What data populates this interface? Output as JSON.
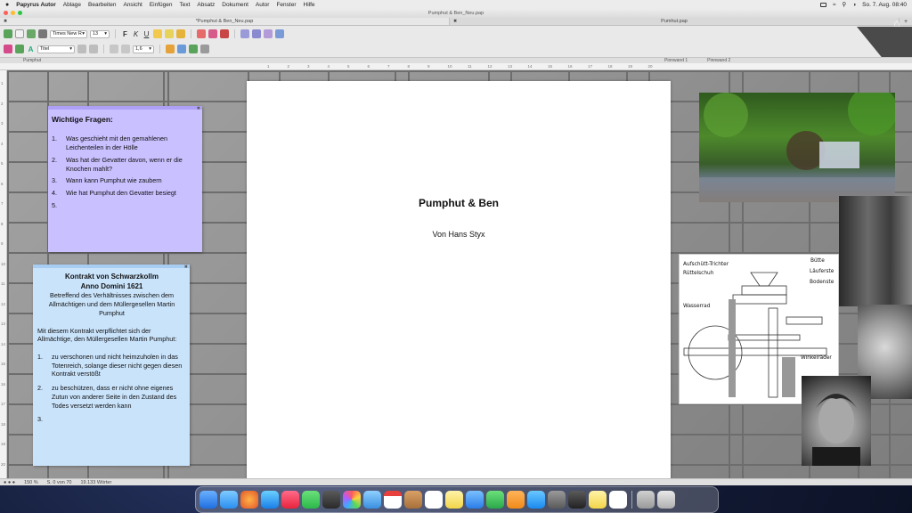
{
  "menubar": {
    "app_name": "Papyrus Autor",
    "items": [
      "Ablage",
      "Bearbeiten",
      "Ansicht",
      "Einfügen",
      "Text",
      "Absatz",
      "Dokument",
      "Autor",
      "Fenster",
      "Hilfe"
    ],
    "clock": "So. 7. Aug. 08:40"
  },
  "window": {
    "title": "Pumphut & Ben_Neu.pap",
    "tabs": [
      {
        "label": "*Pumphut & Ben_Neu.pap"
      },
      {
        "label": "Pumhut.pap"
      }
    ]
  },
  "toolbar": {
    "font_family": "Times New R",
    "font_size": "13",
    "bold_label": "F",
    "italic_label": "K",
    "underline_label": "U",
    "paragraph_style": "Titel",
    "line_spacing": "1,6"
  },
  "styles_row": {
    "left_label": "Pumphut",
    "pinnwand_1": "Pinnwand 1",
    "pinnwand_2": "Pinnwand 2"
  },
  "ruler": {
    "h_ticks": [
      "1",
      "2",
      "3",
      "4",
      "5",
      "6",
      "7",
      "8",
      "9",
      "10",
      "11",
      "12",
      "13",
      "14",
      "15",
      "16",
      "17",
      "18",
      "19",
      "20"
    ],
    "v_ticks": [
      "1",
      "2",
      "3",
      "4",
      "5",
      "6",
      "7",
      "8",
      "9",
      "10",
      "11",
      "12",
      "13",
      "14",
      "15",
      "16",
      "17",
      "18",
      "19",
      "20"
    ]
  },
  "document": {
    "title": "Pumphut & Ben",
    "author": "Von Hans Styx"
  },
  "note_questions": {
    "heading": "Wichtige Fragen:",
    "items": [
      {
        "num": "1.",
        "text": "Was geschieht mit den gemahlenen Leichenteilen in der Hölle"
      },
      {
        "num": "2.",
        "text": "Was hat der Gevatter davon, wenn er die Knochen mahlt?"
      },
      {
        "num": "3.",
        "text": "Wann kann Pumphut wie zaubern"
      },
      {
        "num": "4.",
        "text": "Wie hat Pumphut den Gevatter besiegt"
      },
      {
        "num": "5.",
        "text": ""
      }
    ]
  },
  "note_contract": {
    "title_line1": "Kontrakt von Schwarzkollm",
    "title_line2": "Anno Domini 1621",
    "subtitle": "Betreffend des Verhältnisses zwischen dem Allmächtigen und dem Müllergesellen Martin Pumphut",
    "body": "Mit diesem Kontrakt  verpflichtet sich der Allmächtige, den Müllergesellen Martin Pumphut:",
    "items": [
      {
        "num": "1.",
        "text": "zu verschonen und nicht heimzuholen in das Totenreich, solange dieser nicht gegen diesen Kontrakt verstößt"
      },
      {
        "num": "2.",
        "text": "zu beschützen, dass er nicht ohne eigenes Zutun von anderer Seite in den Zustand des Todes versetzt werden kann"
      },
      {
        "num": "3.",
        "text": ""
      }
    ]
  },
  "diagram_labels": {
    "trichter": "Aufschütt-Trichter",
    "ruettelschuh": "Rüttelschuh",
    "wasserrad": "Wasserrad",
    "buette": "Bütte",
    "laeuferstein": "Läuferste",
    "bodenstein": "Bodenste",
    "winkelraeder": "Winkelräder"
  },
  "statusbar": {
    "zoom": "150 %",
    "page": "S. 0 von 70",
    "words": "19.133 Wörter"
  },
  "colors": {
    "note_purple": "#c9c0ff",
    "note_blue": "#c9e3fb"
  }
}
